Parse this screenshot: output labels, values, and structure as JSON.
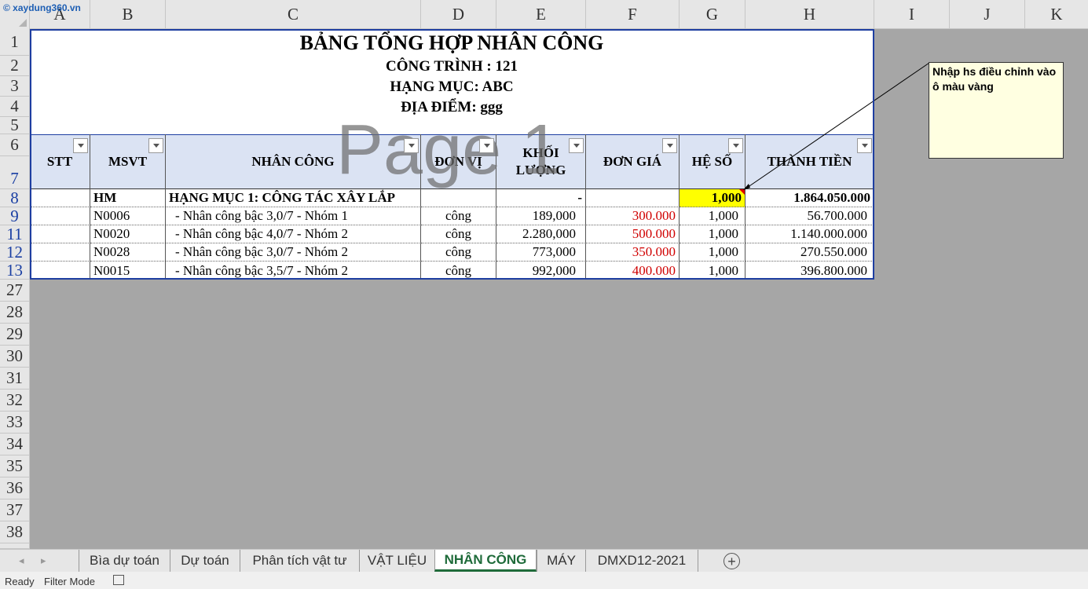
{
  "logo": "© xaydung360.vn",
  "columns": [
    "A",
    "B",
    "C",
    "D",
    "E",
    "F",
    "G",
    "H",
    "I",
    "J",
    "K"
  ],
  "rows": [
    "1",
    "2",
    "3",
    "4",
    "5",
    "6",
    "7",
    "8",
    "9",
    "11",
    "12",
    "13",
    "27",
    "28",
    "29",
    "30",
    "31",
    "32",
    "33",
    "34",
    "35",
    "36",
    "37",
    "38"
  ],
  "titles": {
    "main": "BẢNG TỔNG HỢP NHÂN CÔNG",
    "project": "CÔNG TRÌNH : 121",
    "category": "HẠNG MỤC: ABC",
    "location": "ĐỊA ĐIỂM: ggg"
  },
  "headers": {
    "stt": "STT",
    "msvt": "MSVT",
    "nhan_cong": "NHÂN CÔNG",
    "don_vi": "ĐƠN VỊ",
    "khoi_luong": "KHỐI LƯỢNG",
    "don_gia": "ĐƠN GIÁ",
    "he_so": "HỆ SỐ",
    "thanh_tien": "THÀNH TIỀN"
  },
  "summary_row": {
    "msvt": "HM",
    "name": "HẠNG MỤC 1: CÔNG TÁC XÂY LẮP",
    "khoi_luong": "-",
    "he_so": "1,000",
    "thanh_tien": "1.864.050.000"
  },
  "data_rows": [
    {
      "msvt": "N0006",
      "name": " - Nhân công bậc 3,0/7 - Nhóm 1",
      "unit": "công",
      "qty": "189,000",
      "price": "300.000",
      "coef": "1,000",
      "total": "56.700.000"
    },
    {
      "msvt": "N0020",
      "name": " - Nhân công bậc 4,0/7 - Nhóm 2",
      "unit": "công",
      "qty": "2.280,000",
      "price": "500.000",
      "coef": "1,000",
      "total": "1.140.000.000"
    },
    {
      "msvt": "N0028",
      "name": " - Nhân công bậc 3,0/7 - Nhóm 2",
      "unit": "công",
      "qty": "773,000",
      "price": "350.000",
      "coef": "1,000",
      "total": "270.550.000"
    },
    {
      "msvt": "N0015",
      "name": " - Nhân công bậc 3,5/7 - Nhóm 2",
      "unit": "công",
      "qty": "992,000",
      "price": "400.000",
      "coef": "1,000",
      "total": "396.800.000"
    }
  ],
  "watermark": "Page 1",
  "comment": "Nhập hs điều chỉnh vào ô màu vàng",
  "tabs": [
    "Bìa dự toán",
    "Dự toán",
    "Phân tích vật tư",
    "VẬT LIỆU",
    "NHÂN CÔNG",
    "MÁY",
    "DMXD12-2021"
  ],
  "active_tab": "NHÂN CÔNG",
  "status": {
    "ready": "Ready",
    "mode": "Filter Mode"
  },
  "colors": {
    "accent": "#1f6b3a",
    "print_border": "#1e3ea1",
    "header_fill": "#dbe3f3",
    "highlight": "#ffff00",
    "price_red": "#d00000"
  }
}
